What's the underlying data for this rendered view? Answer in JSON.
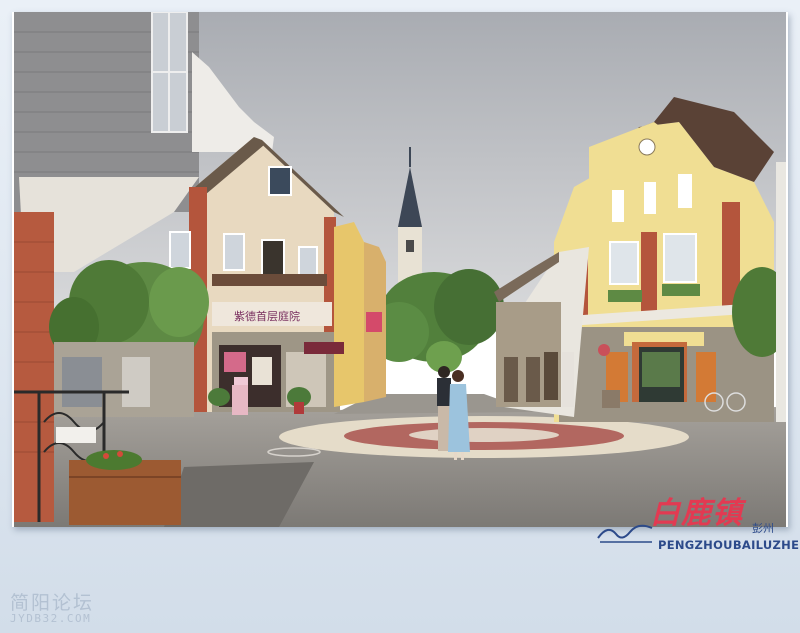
{
  "photo": {
    "subject": "european-style-town-square-street-scene",
    "shop_sign_text": "紫德首层庭院",
    "colors": {
      "sky": "#b9bcc1",
      "pavement": "#8f8c88",
      "cream_building": "#e8d9c0",
      "yellow_building": "#f0de93",
      "brick": "#b4553c",
      "stone": "#9b9384",
      "tree": "#5e8a44",
      "mosaic_red": "#b26760",
      "mosaic_cream": "#e5dcc9",
      "dress_blue": "#9cc3dd"
    }
  },
  "watermark": {
    "brand_chinese": "白鹿镇",
    "brand_small": "彭州",
    "brand_latin": "PENGZHOUBAILUZHEN",
    "color": "#e23a52",
    "latin_color": "#2c4a8a"
  },
  "forum": {
    "name": "简阳论坛",
    "url": "JYDB32.COM"
  }
}
